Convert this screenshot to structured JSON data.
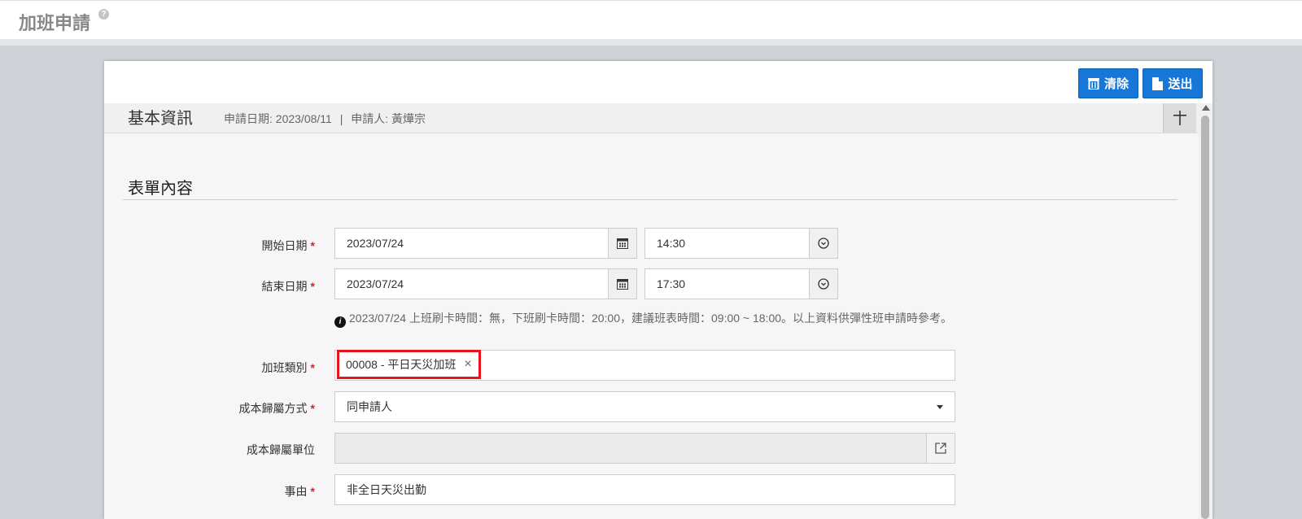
{
  "header": {
    "title": "加班申請",
    "help_icon": "?"
  },
  "toolbar": {
    "clear_label": "清除",
    "submit_label": "送出",
    "accent_color": "#1777d7"
  },
  "basic_info": {
    "title": "基本資訊",
    "apply_date": "申請日期: 2023/08/11",
    "separator": "|",
    "applicant": "申請人: 黃燁宗",
    "collapse_symbol": "+"
  },
  "form": {
    "section_title": "表單內容",
    "start": {
      "label": "開始日期",
      "required": "*",
      "date": "2023/07/24",
      "time": "14:30"
    },
    "end": {
      "label": "結束日期",
      "required": "*",
      "date": "2023/07/24",
      "time": "17:30"
    },
    "hint_icon": "i",
    "hint_text": "2023/07/24 上班刷卡時間：無，下班刷卡時間：20:00，建議班表時間：09:00 ~ 18:00。以上資料供彈性班申請時參考。",
    "ot_type": {
      "label": "加班類別",
      "required": "*",
      "value": "00008 - 平日天災加班",
      "remove": "×"
    },
    "cost_method": {
      "label": "成本歸屬方式",
      "required": "*",
      "value": "同申請人"
    },
    "cost_unit": {
      "label": "成本歸屬單位",
      "value": ""
    },
    "reason": {
      "label": "事由",
      "required": "*",
      "value": "非全日天災出勤"
    }
  }
}
